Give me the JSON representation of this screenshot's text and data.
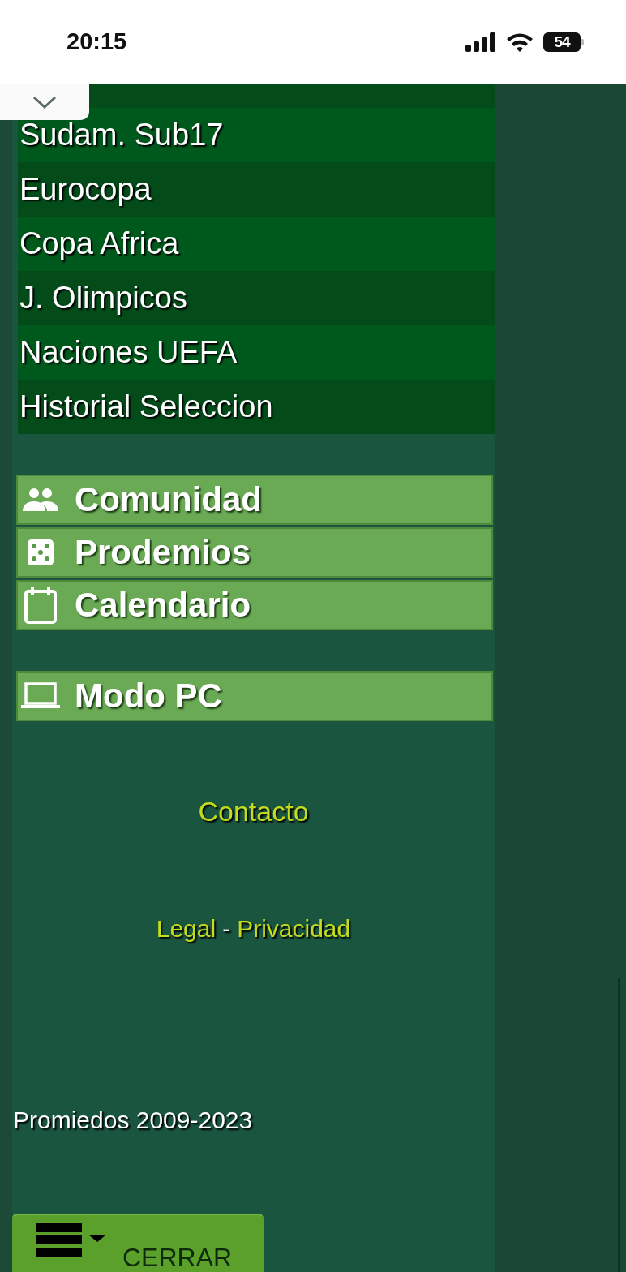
{
  "status_bar": {
    "time": "20:15",
    "battery": "54"
  },
  "menu": {
    "items": [
      {
        "label": "Sudam. Sub17"
      },
      {
        "label": "Eurocopa"
      },
      {
        "label": "Copa Africa"
      },
      {
        "label": "J. Olimpicos"
      },
      {
        "label": "Naciones UEFA"
      },
      {
        "label": "Historial Seleccion"
      }
    ]
  },
  "sections": [
    {
      "label": "Comunidad",
      "kind": "people"
    },
    {
      "label": "Prodemios",
      "kind": "dice"
    },
    {
      "label": "Calendario",
      "kind": "calendar"
    }
  ],
  "mode_button": {
    "label": "Modo PC",
    "kind": "laptop"
  },
  "footer": {
    "contact": "Contacto",
    "legal": "Legal",
    "separator": "-",
    "privacy": "Privacidad",
    "copyright": "Promiedos 2009-2023"
  },
  "close_button": {
    "label": "CERRAR"
  }
}
